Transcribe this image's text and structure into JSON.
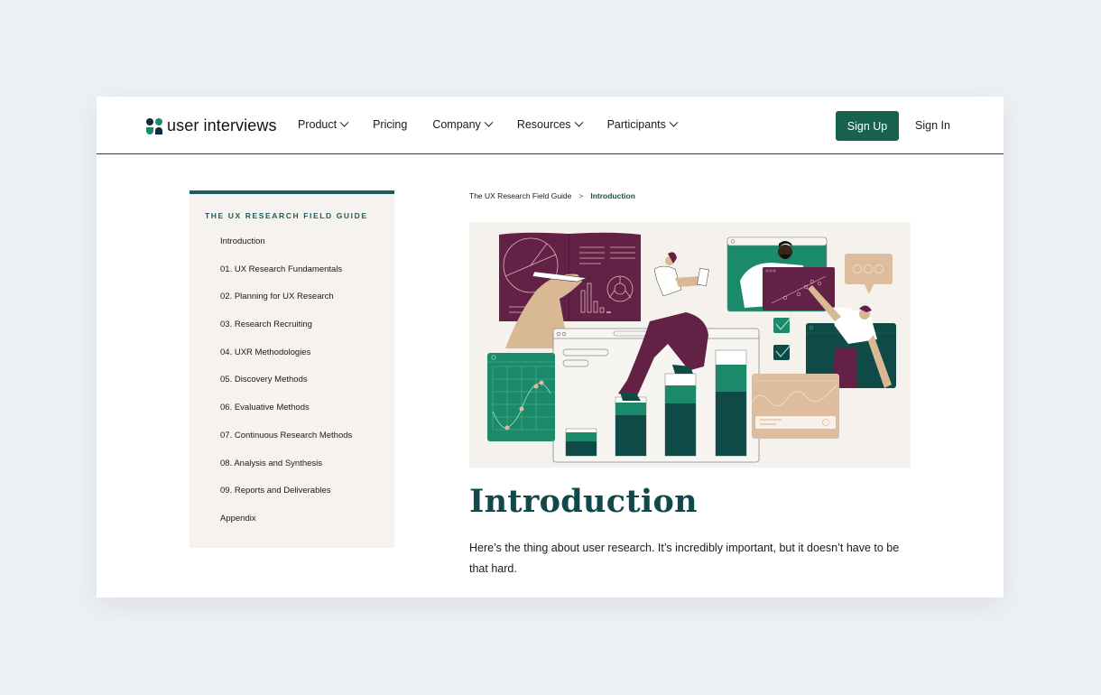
{
  "header": {
    "logo_text": "user interviews",
    "nav": [
      {
        "label": "Product",
        "has_dropdown": true
      },
      {
        "label": "Pricing",
        "has_dropdown": false
      },
      {
        "label": "Company",
        "has_dropdown": true
      },
      {
        "label": "Resources",
        "has_dropdown": true
      },
      {
        "label": "Participants",
        "has_dropdown": true
      }
    ],
    "signup_label": "Sign Up",
    "signin_label": "Sign In"
  },
  "sidebar": {
    "title": "THE UX RESEARCH FIELD GUIDE",
    "items": [
      {
        "label": "Introduction"
      },
      {
        "label": "01. UX Research Fundamentals"
      },
      {
        "label": "02. Planning for UX Research"
      },
      {
        "label": "03. Research Recruiting"
      },
      {
        "label": "04. UXR Methodologies"
      },
      {
        "label": "05. Discovery Methods"
      },
      {
        "label": "06. Evaluative Methods"
      },
      {
        "label": "07. Continuous Research Methods"
      },
      {
        "label": "08. Analysis and Synthesis"
      },
      {
        "label": "09. Reports and Deliverables"
      },
      {
        "label": "Appendix"
      }
    ]
  },
  "breadcrumb": {
    "parent": "The UX Research Field Guide",
    "separator": ">",
    "current": "Introduction"
  },
  "hero": {
    "icon": "ux-research-illustration",
    "colors": {
      "background": "#f5f2ee",
      "plum": "#632245",
      "teal": "#1b8a6b",
      "dark_teal": "#0f4a47",
      "tan": "#ddbd9d",
      "skin": "#d9b894"
    }
  },
  "main": {
    "title": "Introduction",
    "intro": "Here’s the thing about user research. It’s incredibly important, but it doesn’t have to be that hard."
  },
  "colors": {
    "brand": "#17614f",
    "heading": "#11494a",
    "sidebar_bg": "#f5f2ef",
    "page_bg": "#eef1f4"
  }
}
